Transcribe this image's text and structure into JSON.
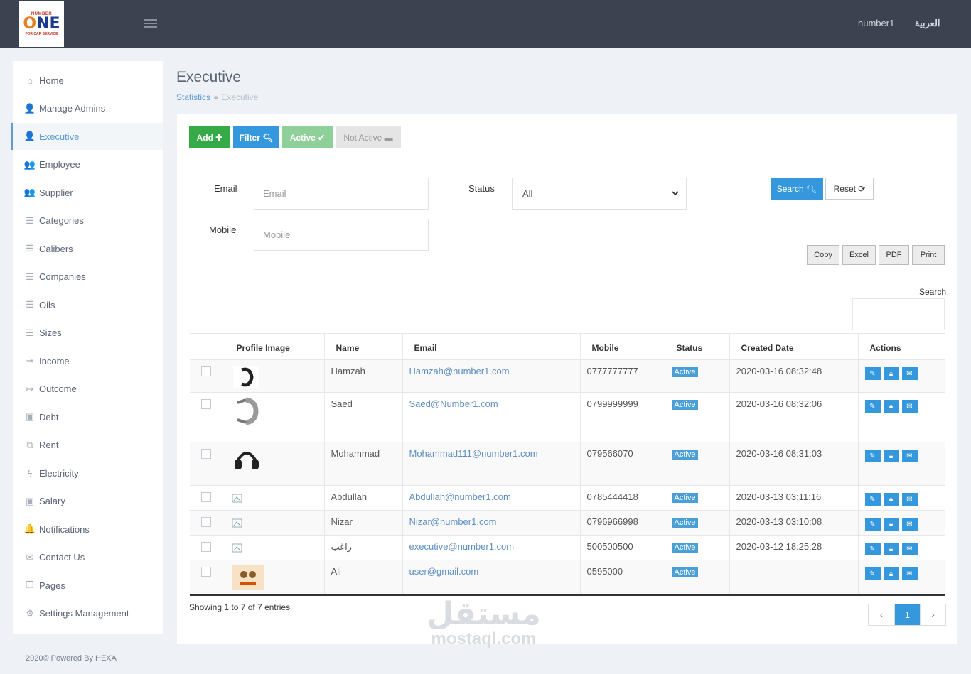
{
  "header": {
    "logo_top": "NUMBER",
    "logo_main_a": "O",
    "logo_main_b": "NE",
    "logo_sub": "FOR CAR SERVICE",
    "user": "number1",
    "language": "العربية"
  },
  "sidebar": {
    "items": [
      {
        "label": "Home",
        "icon": "home-icon",
        "glyph": "⌂"
      },
      {
        "label": "Manage Admins",
        "icon": "user-icon",
        "glyph": "👤"
      },
      {
        "label": "Executive",
        "icon": "user-icon",
        "glyph": "👤"
      },
      {
        "label": "Employee",
        "icon": "users-icon",
        "glyph": "👥"
      },
      {
        "label": "Supplier",
        "icon": "users-icon",
        "glyph": "👥"
      },
      {
        "label": "Categories",
        "icon": "list-icon",
        "glyph": "☰"
      },
      {
        "label": "Calibers",
        "icon": "list-icon",
        "glyph": "☰"
      },
      {
        "label": "Companies",
        "icon": "list-icon",
        "glyph": "☰"
      },
      {
        "label": "Oils",
        "icon": "list-icon",
        "glyph": "☰"
      },
      {
        "label": "Sizes",
        "icon": "list-icon",
        "glyph": "☰"
      },
      {
        "label": "Income",
        "icon": "login-icon",
        "glyph": "⇥"
      },
      {
        "label": "Outcome",
        "icon": "logout-icon",
        "glyph": "↦"
      },
      {
        "label": "Debt",
        "icon": "money-icon",
        "glyph": "▣"
      },
      {
        "label": "Rent",
        "icon": "docs-icon",
        "glyph": "⧉"
      },
      {
        "label": "Electricity",
        "icon": "bolt-icon",
        "glyph": "ϟ"
      },
      {
        "label": "Salary",
        "icon": "money-icon",
        "glyph": "▣"
      },
      {
        "label": "Notifications",
        "icon": "bell-icon",
        "glyph": "🔔"
      },
      {
        "label": "Contact Us",
        "icon": "envelope-icon",
        "glyph": "✉"
      },
      {
        "label": "Pages",
        "icon": "pages-icon",
        "glyph": "❐"
      },
      {
        "label": "Settings Management",
        "icon": "gears-icon",
        "glyph": "⚙"
      }
    ]
  },
  "footer": "2020© Powered By HEXA",
  "page": {
    "title": "Executive",
    "breadcrumb_root": "Statistics",
    "breadcrumb_current": "Executive"
  },
  "toolbar": {
    "add": "Add ✚",
    "filter": "Filter 🔍︎",
    "active": "Active ✔",
    "not_active": "Not Active ▬"
  },
  "filters": {
    "email_label": "Email",
    "email_placeholder": "Email",
    "mobile_label": "Mobile",
    "mobile_placeholder": "Mobile",
    "status_label": "Status",
    "status_value": "All",
    "search": "Search 🔍︎",
    "reset": "Reset ⟳"
  },
  "export": {
    "copy": "Copy",
    "excel": "Excel",
    "pdf": "PDF",
    "print": "Print"
  },
  "table": {
    "search_label": "Search",
    "columns": [
      "Profile Image",
      "Name",
      "Email",
      "Mobile",
      "Status",
      "Created Date",
      "Actions"
    ],
    "rows": [
      {
        "name": "Hamzah",
        "email": "Hamzah@number1.com",
        "mobile": "0777777777",
        "status": "Active",
        "created": "2020-03-16 08:32:48",
        "image": "watch-band-dark"
      },
      {
        "name": "Saed",
        "email": "Saed@Number1.com",
        "mobile": "0799999999",
        "status": "Active",
        "created": "2020-03-16 08:32:06",
        "image": "watch-band-steel"
      },
      {
        "name": "Mohammad",
        "email": "Mohammad111@number1.com",
        "mobile": "079566070",
        "status": "Active",
        "created": "2020-03-16 08:31:03",
        "image": "headphones"
      },
      {
        "name": "Abdullah",
        "email": "Abdullah@number1.com",
        "mobile": "0785444418",
        "status": "Active",
        "created": "2020-03-13 03:11:16",
        "image": "broken-image"
      },
      {
        "name": "Nizar",
        "email": "Nizar@number1.com",
        "mobile": "0796966998",
        "status": "Active",
        "created": "2020-03-13 03:10:08",
        "image": "broken-image"
      },
      {
        "name": "راغب",
        "email": "executive@number1.com",
        "mobile": "500500500",
        "status": "Active",
        "created": "2020-03-12 18:25:28",
        "image": "broken-image"
      },
      {
        "name": "Ali",
        "email": "user@gmail.com",
        "mobile": "0595000",
        "status": "Active",
        "created": "",
        "image": "cartoon-logo"
      }
    ]
  },
  "pagination": {
    "showing": "Showing 1 to 7 of 7 entries",
    "prev": "‹",
    "current": "1",
    "next": "›"
  },
  "watermark": {
    "arabic": "مستقل",
    "latin": "mostaql.com"
  },
  "colors": {
    "topbar": "#3d4250",
    "primary": "#3598dc",
    "success": "#35aa47"
  }
}
